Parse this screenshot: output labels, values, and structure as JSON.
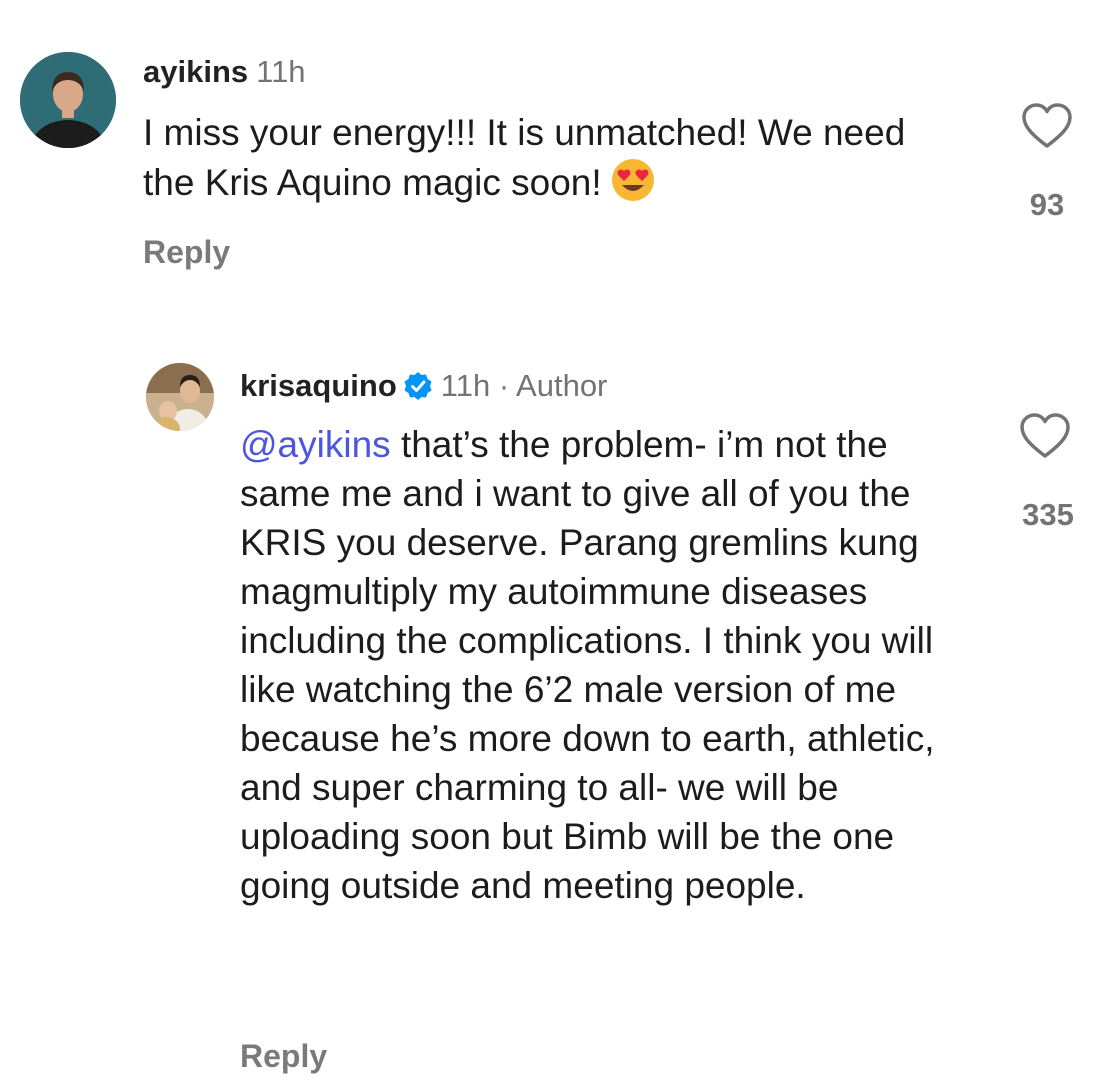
{
  "comments": [
    {
      "username": "ayikins",
      "time": "11h",
      "text": "I miss your energy!!! It is unmatched! We need the Kris Aquino magic soon!",
      "emoji": "heart-eyes-emoji",
      "reply_label": "Reply",
      "like_count": "93",
      "avatar": "ayikins-avatar"
    },
    {
      "username": "krisaquino",
      "verified": true,
      "time": "11h",
      "separator": "·",
      "author_label": "Author",
      "mention": "@ayikins",
      "text": "that’s the problem- i’m not the same me and i want to give all of you the KRIS you deserve. Parang gremlins kung magmultiply my autoimmune diseases including the complications. I think you will like watching the 6’2 male version of me because he’s more down to earth, athletic, and super charming to all- we will be uploading soon but Bimb will be the one going outside and meeting people.",
      "reply_label": "Reply",
      "like_count": "335",
      "avatar": "krisaquino-avatar"
    }
  ],
  "colors": {
    "mention": "#4a56e0",
    "muted": "#737373",
    "verified": "#0095f6"
  },
  "icons": [
    "heart-outline-icon",
    "verified-badge-icon",
    "heart-eyes-emoji"
  ]
}
